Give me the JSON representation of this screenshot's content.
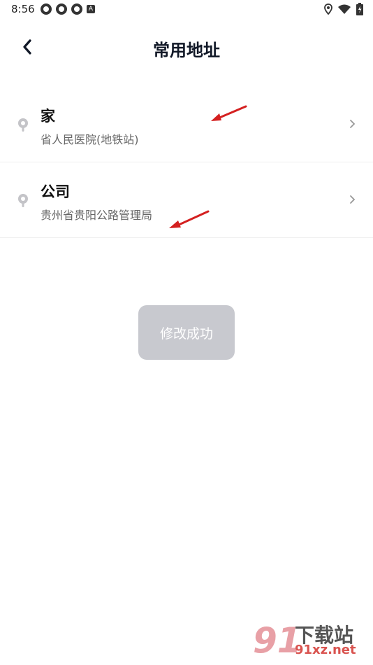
{
  "status_bar": {
    "time": "8:56",
    "left_icons": [
      "notification-icon",
      "notification-icon",
      "notification-icon",
      "a-icon"
    ],
    "right_icons": [
      "location-icon",
      "wifi-icon",
      "battery-icon"
    ],
    "a_glyph": "A"
  },
  "header": {
    "back_icon": "chevron-left-icon",
    "title": "常用地址"
  },
  "addresses": [
    {
      "name": "家",
      "detail": "省人民医院(地铁站)",
      "icon": "location-pin-icon"
    },
    {
      "name": "公司",
      "detail": "贵州省贵阳公路管理局",
      "icon": "location-pin-icon"
    }
  ],
  "toast": {
    "text": "修改成功"
  },
  "watermark": {
    "digits": "91",
    "text": "下载站",
    "url": "91xz.net"
  },
  "colors": {
    "title": "#111827",
    "toast_bg": "#c8c9cf",
    "annotation_arrow": "#d42020"
  }
}
